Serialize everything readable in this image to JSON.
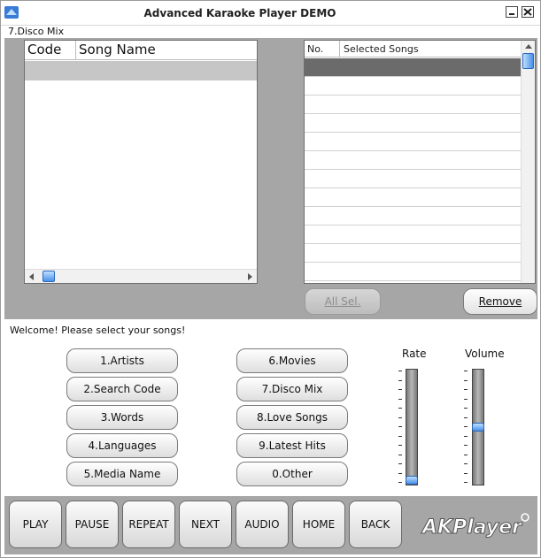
{
  "window": {
    "title": "Advanced Karaoke Player DEMO"
  },
  "category": "7.Disco Mix",
  "left_list": {
    "columns": [
      "Code",
      "Song Name"
    ]
  },
  "right_list": {
    "columns": [
      "No.",
      "Selected Songs"
    ]
  },
  "buttons": {
    "all_sel": "All Sel.",
    "remove": "Remove"
  },
  "welcome": "Welcome!  Please select your songs!",
  "menu": {
    "left": [
      "1.Artists",
      "2.Search Code",
      "3.Words",
      "4.Languages",
      "5.Media Name"
    ],
    "right": [
      "6.Movies",
      "7.Disco Mix",
      "8.Love Songs",
      "9.Latest Hits",
      "0.Other"
    ]
  },
  "sliders": {
    "rate": {
      "label": "Rate",
      "level": 0.0
    },
    "volume": {
      "label": "Volume",
      "level": 0.5
    }
  },
  "controls": [
    "PLAY",
    "PAUSE",
    "REPEAT",
    "NEXT",
    "AUDIO",
    "HOME",
    "BACK"
  ],
  "logo": "AKPlayer",
  "colors": {
    "panel": "#a6a6a6",
    "accent": "#4a90e8",
    "selected_row": "#6b6b6b"
  }
}
